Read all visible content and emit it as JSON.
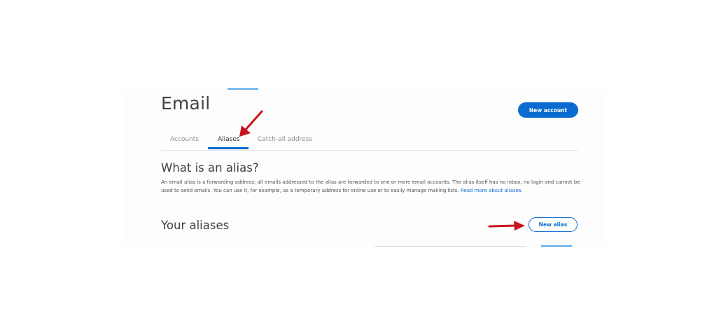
{
  "header": {
    "title": "Email",
    "new_account_label": "New account"
  },
  "tabs": [
    {
      "label": "Accounts",
      "active": false
    },
    {
      "label": "Aliases",
      "active": true
    },
    {
      "label": "Catch-all address",
      "active": false
    }
  ],
  "intro": {
    "heading": "What is an alias?",
    "body": "An email alias is a forwarding address; all emails addressed to the alias are forwarded to one or more email accounts. The alias itself has no inbox, no login and cannot be used to send emails. You can use it, for example, as a temporary address for online use or to easily manage mailing lists.",
    "link_text": "Read more about aliases."
  },
  "aliases": {
    "heading": "Your aliases",
    "new_alias_label": "New alias"
  },
  "colors": {
    "accent": "#0a6cd0",
    "annotation_arrow": "#c8151b",
    "heading_text": "#3f4447"
  },
  "annotations": [
    "arrow pointing to Aliases tab",
    "arrow pointing to New alias button"
  ]
}
